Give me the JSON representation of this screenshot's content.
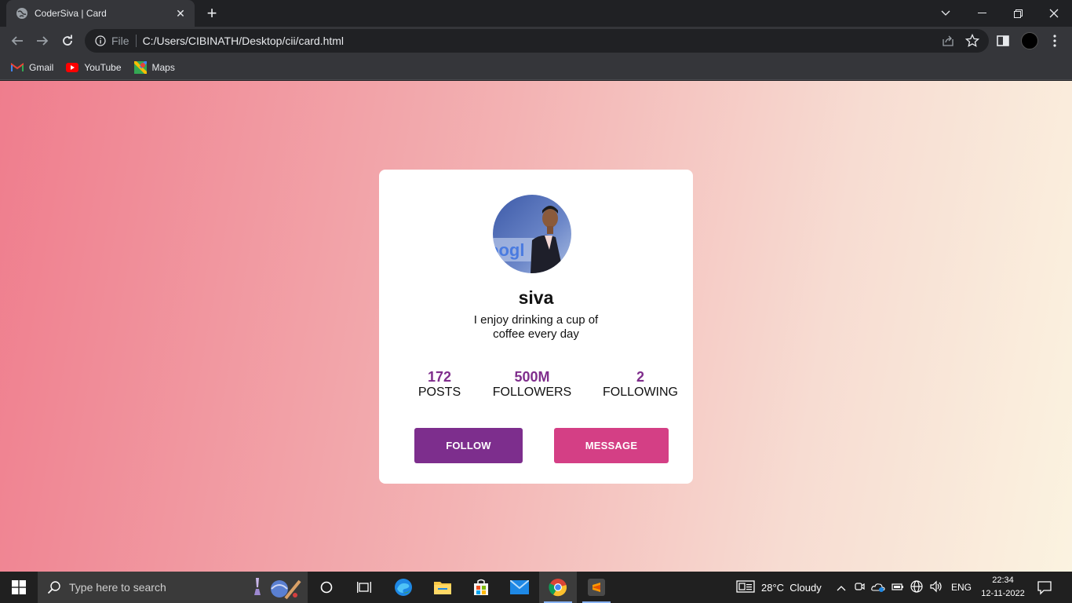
{
  "browser": {
    "tab_title": "CoderSiva | Card",
    "address_scheme": "File",
    "address_url": "C:/Users/CIBINATH/Desktop/cii/card.html",
    "bookmarks": [
      {
        "label": "Gmail",
        "icon": "gmail-icon"
      },
      {
        "label": "YouTube",
        "icon": "youtube-icon"
      },
      {
        "label": "Maps",
        "icon": "maps-icon"
      }
    ]
  },
  "profile_card": {
    "name": "siva",
    "bio_line1": "I enjoy drinking a cup of",
    "bio_line2": "coffee every day",
    "stats": [
      {
        "value": "172",
        "label": "POSTS"
      },
      {
        "value": "500M",
        "label": "FOLLOWERS"
      },
      {
        "value": "2",
        "label": "FOLLOWING"
      }
    ],
    "follow_label": "FOLLOW",
    "message_label": "MESSAGE"
  },
  "colors": {
    "accent_purple": "#7d2e8d",
    "accent_pink": "#d43f85",
    "gradient_start": "#ef7d8d",
    "gradient_end": "#fbf3e0"
  },
  "taskbar": {
    "search_placeholder": "Type here to search",
    "weather": "28°C  Cloudy",
    "language": "ENG",
    "time": "22:34",
    "date": "12-11-2022"
  }
}
